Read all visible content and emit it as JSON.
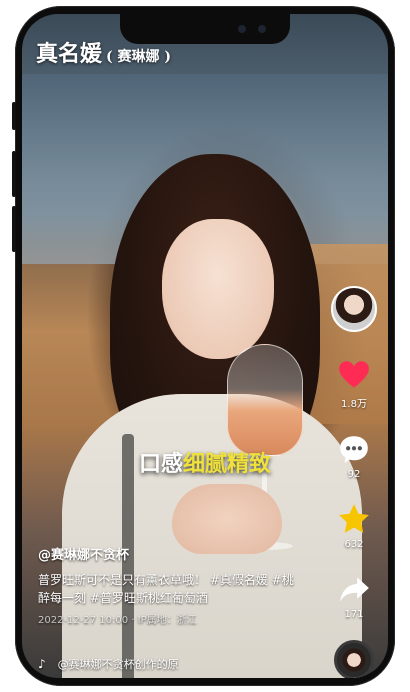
{
  "header": {
    "title": "真名媛",
    "subtitle": "( 赛琳娜 )"
  },
  "video": {
    "caption_white": "口感",
    "caption_yellow": "细腻精致"
  },
  "actions": {
    "like_count": "1.8万",
    "comment_count": "92",
    "favorite_count": "632",
    "share_count": "171"
  },
  "post": {
    "author": "@赛琳娜不贪杯",
    "description": "普罗旺斯可不是只有薰衣草哦！ #真假名媛 #桃醉每一刻 #普罗旺斯桃红葡萄酒",
    "meta": "2022-12-27 10:00 · IP属地：浙江",
    "music": "@赛琳娜不贪杯创作的原"
  },
  "colors": {
    "accent_red": "#fe2c55",
    "caption_yellow": "#f0e03a",
    "star_yellow": "#f7c400"
  },
  "icons": {
    "like": "heart-icon",
    "comment": "comment-bubble-icon",
    "favorite": "star-icon",
    "share": "share-arrow-icon",
    "music": "tiktok-note-icon"
  }
}
